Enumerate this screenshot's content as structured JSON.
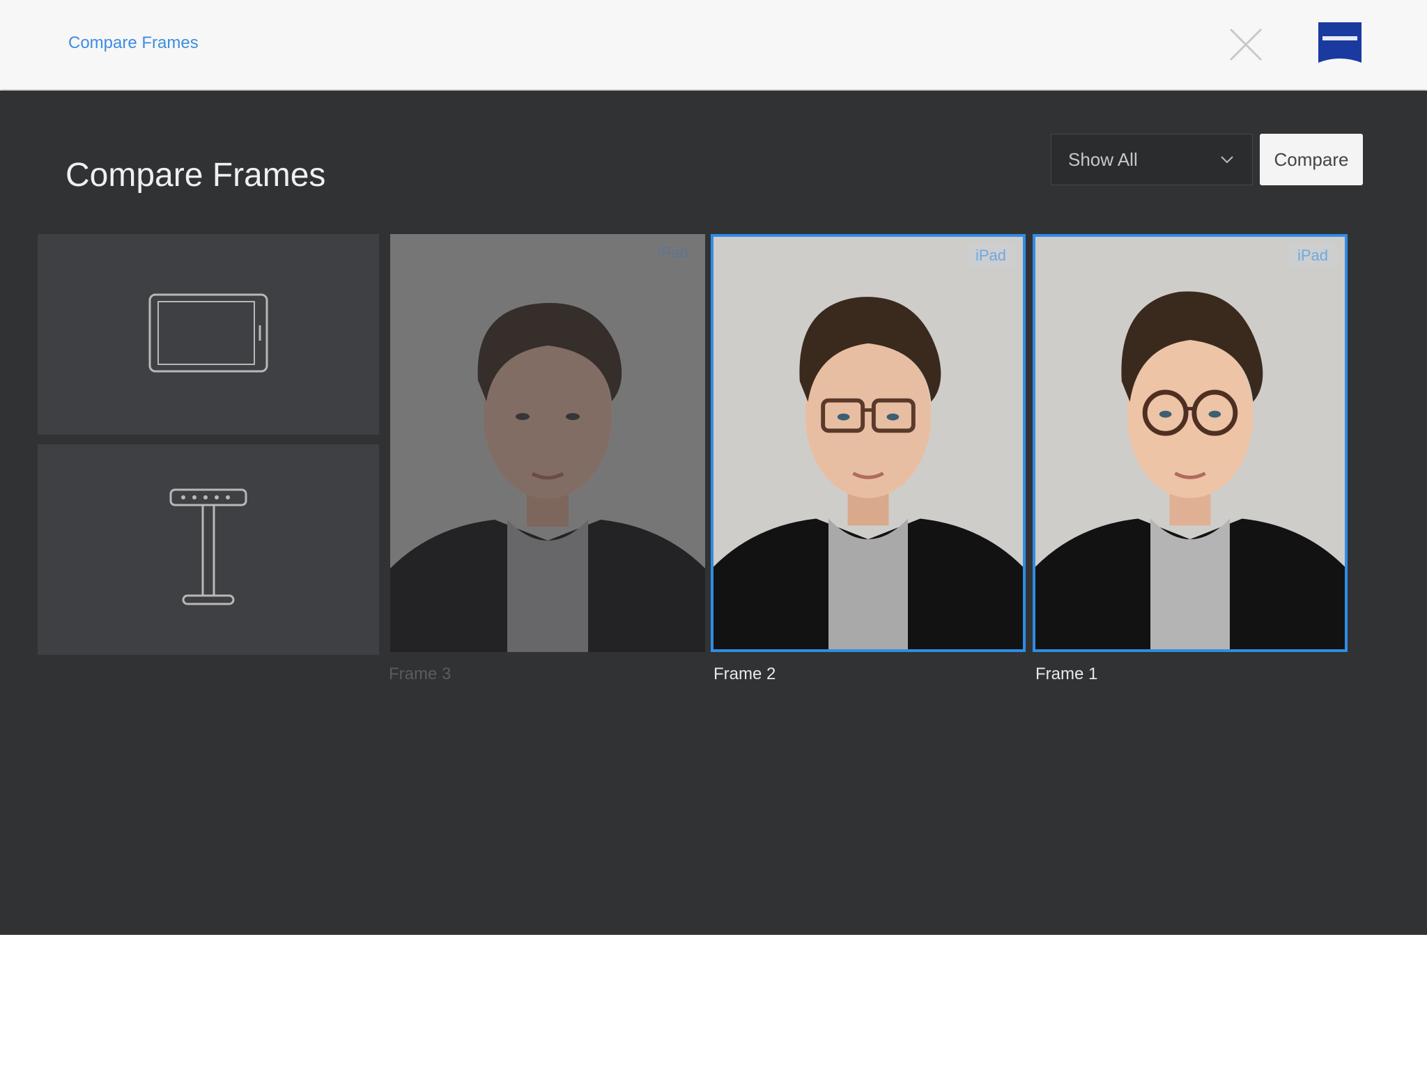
{
  "header": {
    "breadcrumb": "Compare Frames"
  },
  "main": {
    "title": "Compare Frames",
    "filter": {
      "selected": "Show All"
    },
    "compare_label": "Compare"
  },
  "devices": [
    {
      "icon": "tablet-icon"
    },
    {
      "icon": "camera-stand-icon"
    }
  ],
  "frames": [
    {
      "label": "Frame 3",
      "device": "iPad",
      "selected": false,
      "glasses": "none"
    },
    {
      "label": "Frame 2",
      "device": "iPad",
      "selected": true,
      "glasses": "rectangular"
    },
    {
      "label": "Frame 1",
      "device": "iPad",
      "selected": true,
      "glasses": "round"
    }
  ],
  "colors": {
    "accent": "#2f8de4",
    "background": "#313234",
    "tile": "#3f4043",
    "brand": "#1a3aa0"
  }
}
